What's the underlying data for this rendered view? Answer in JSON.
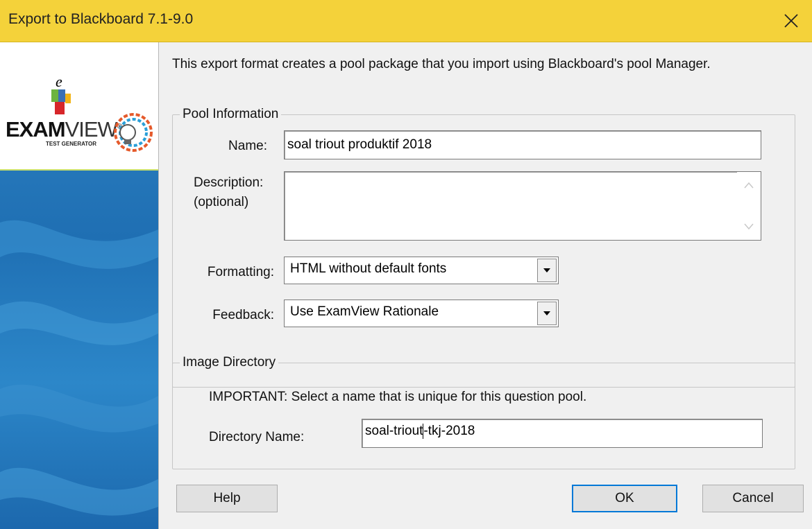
{
  "window": {
    "title": "Export to Blackboard 7.1-9.0",
    "close_icon": "close-icon"
  },
  "logo": {
    "brand_bold": "EXAM",
    "brand_regular": "VIEW",
    "registered": "®",
    "subtitle": "TEST GENERATOR"
  },
  "intro_text": "This export format creates a pool package that you import using Blackboard's pool Manager.",
  "pool_info": {
    "legend": "Pool Information",
    "name_label": "Name:",
    "name_value": "soal triout produktif 2018",
    "description_label_1": "Description:",
    "description_label_2": "(optional)",
    "description_value": "",
    "formatting_label": "Formatting:",
    "formatting_value": "HTML without default fonts",
    "feedback_label": "Feedback:",
    "feedback_value": "Use ExamView Rationale"
  },
  "image_dir": {
    "legend": "Image Directory",
    "important_text": "IMPORTANT: Select a name that is unique for this question pool.",
    "dir_label": "Directory Name:",
    "dir_value_before_caret": "soal-triout",
    "dir_value_after_caret": "-tkj-2018"
  },
  "buttons": {
    "help": "Help",
    "ok": "OK",
    "cancel": "Cancel"
  },
  "colors": {
    "titlebar": "#f4d23a",
    "sidebar_blue": "#2276ba",
    "focus_blue": "#0078d7"
  }
}
